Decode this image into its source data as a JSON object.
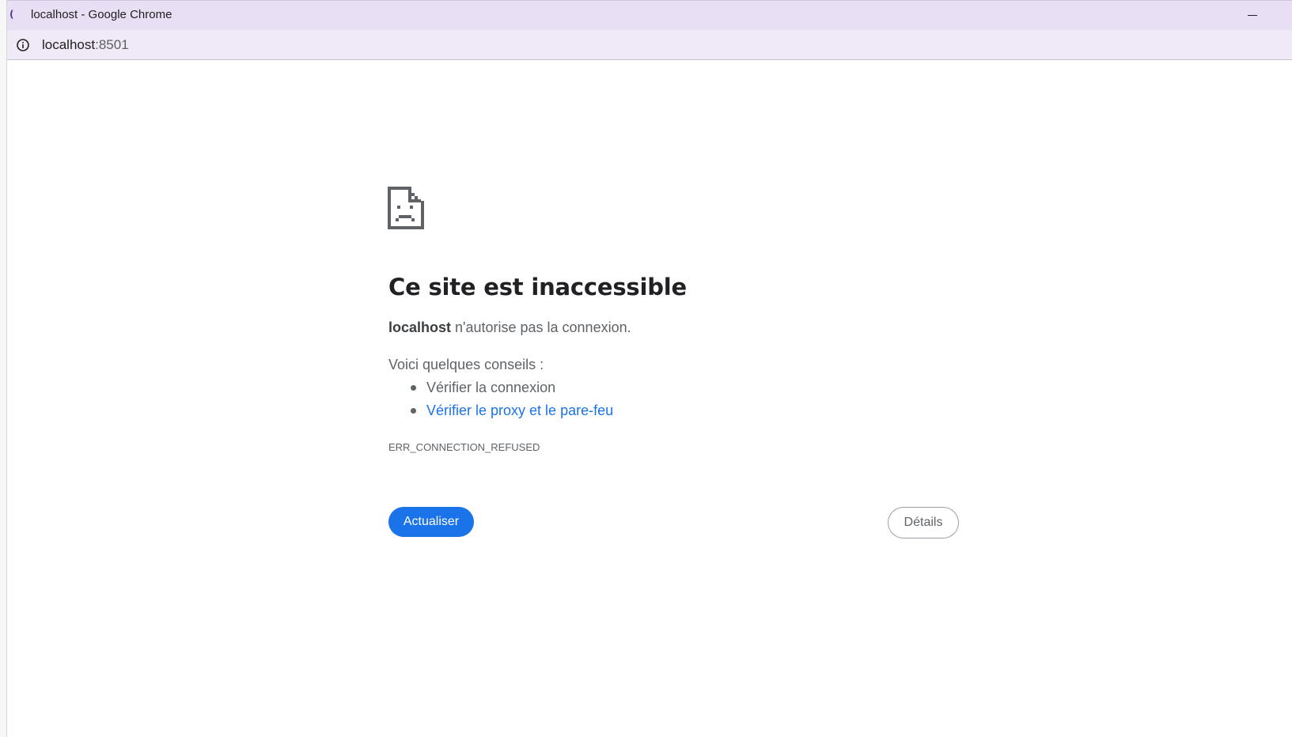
{
  "window": {
    "title": "localhost - Google Chrome",
    "favicon_glyph": "(",
    "minimize_icon": "minimize-icon"
  },
  "address_bar": {
    "host": "localhost",
    "port": ":8501",
    "info_icon": "info-icon"
  },
  "error_page": {
    "icon": "sad-page-icon",
    "heading": "Ce site est inaccessible",
    "message_host": "localhost",
    "message_rest": " n'autorise pas la connexion.",
    "tips_intro": "Voici quelques conseils :",
    "tips": [
      {
        "label": "Vérifier la connexion",
        "is_link": false
      },
      {
        "label": "Vérifier le proxy et le pare-feu",
        "is_link": true
      }
    ],
    "error_code": "ERR_CONNECTION_REFUSED",
    "reload_button": "Actualiser",
    "details_button": "Détails"
  },
  "colors": {
    "titlebar": "#e9dff5",
    "addressbar": "#f0e9f7",
    "primary_button": "#1a73e8",
    "link": "#1a73e8",
    "body_text": "#5f6368",
    "heading_text": "#202124"
  }
}
